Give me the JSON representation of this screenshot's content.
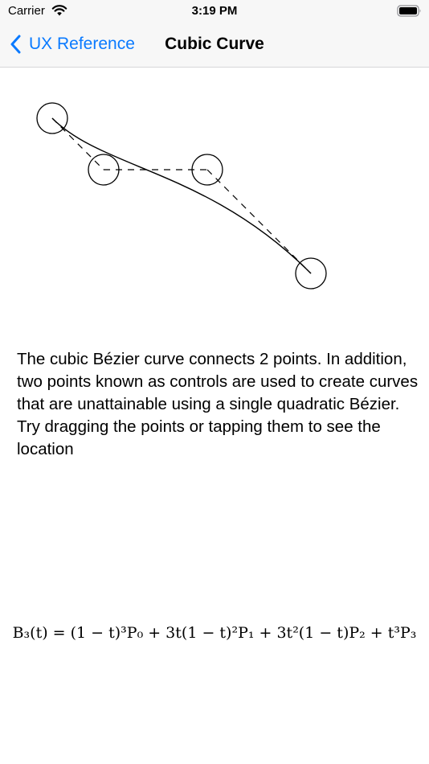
{
  "status_bar": {
    "carrier": "Carrier",
    "time": "3:19 PM"
  },
  "nav": {
    "back_label": "UX Reference",
    "title": "Cubic Curve"
  },
  "curve": {
    "stroke_color": "#000000",
    "point_fill": "none"
  },
  "description": {
    "paragraph_1": "The cubic Bézier curve connects 2 points. In addition, two points known as controls are used to create curves that are unattainable using a single quadratic Bézier.",
    "paragraph_2": "Try dragging the points or tapping them to see the location"
  },
  "formula": {
    "text": "B₃(t) = (1 − t)³P₀ + 3t(1 − t)²P₁ + 3t²(1 − t)P₂ + t³P₃"
  },
  "colors": {
    "accent": "#0a7aff",
    "bar_background": "#f7f7f7"
  }
}
